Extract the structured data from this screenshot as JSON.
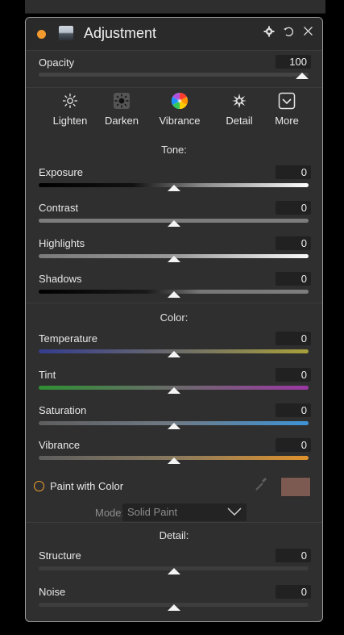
{
  "panel": {
    "title": "Adjustment",
    "accent_color": "#f39a2e",
    "header_icons": [
      "gear-icon",
      "reset-icon",
      "close-icon"
    ]
  },
  "opacity": {
    "label": "Opacity",
    "value": "100",
    "level": 1.0
  },
  "tabs": [
    {
      "label": "Lighten",
      "icon": "sun-outline-icon"
    },
    {
      "label": "Darken",
      "icon": "sun-filled-icon"
    },
    {
      "label": "Vibrance",
      "icon": "color-wheel-icon"
    },
    {
      "label": "Detail",
      "icon": "sparkle-icon"
    },
    {
      "label": "More",
      "icon": "chevron-down-box-icon"
    }
  ],
  "tone": {
    "title": "Tone:",
    "sliders": [
      {
        "label": "Exposure",
        "value": "0",
        "level": 0.5
      },
      {
        "label": "Contrast",
        "value": "0",
        "level": 0.5
      },
      {
        "label": "Highlights",
        "value": "0",
        "level": 0.5
      },
      {
        "label": "Shadows",
        "value": "0",
        "level": 0.5
      }
    ]
  },
  "color": {
    "title": "Color:",
    "sliders": [
      {
        "label": "Temperature",
        "value": "0",
        "level": 0.5
      },
      {
        "label": "Tint",
        "value": "0",
        "level": 0.5
      },
      {
        "label": "Saturation",
        "value": "0",
        "level": 0.5
      },
      {
        "label": "Vibrance",
        "value": "0",
        "level": 0.5
      }
    ]
  },
  "paint": {
    "label": "Paint with Color",
    "swatch_color": "#7c5a52",
    "mode_label": "Mode:",
    "mode_value": "Solid Paint"
  },
  "detail": {
    "title": "Detail:",
    "sliders": [
      {
        "label": "Structure",
        "value": "0",
        "level": 0.5
      },
      {
        "label": "Noise",
        "value": "0",
        "level": 0.5
      }
    ]
  }
}
